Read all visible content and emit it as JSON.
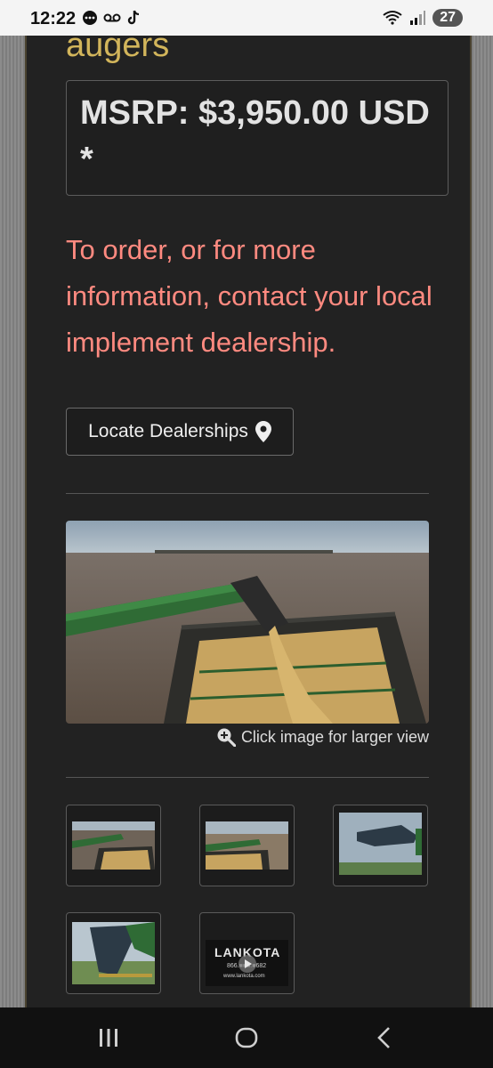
{
  "status_bar": {
    "time": "12:22",
    "left_icons": [
      "chat-icon",
      "voicemail-icon",
      "tiktok-icon"
    ],
    "battery": "27"
  },
  "product": {
    "heading": "augers",
    "msrp": "MSRP: $3,950.00 USD *",
    "contact": "To order, or for more information, contact your local implement dealership.",
    "locate_button": "Locate Dealerships",
    "zoom_caption": "Click image for larger view"
  },
  "thumbnails": [
    {
      "name": "thumb-auger-unloading-1"
    },
    {
      "name": "thumb-auger-unloading-2"
    },
    {
      "name": "thumb-auger-spout-sky"
    },
    {
      "name": "thumb-auger-spout-closeup"
    },
    {
      "name": "thumb-lankota-video",
      "logo_text": "LANKOTA",
      "phone": "866.■■■.■682",
      "site": "www.lankota.com"
    }
  ],
  "nav": {
    "icons": [
      "recent-apps-icon",
      "home-icon",
      "back-icon"
    ]
  },
  "colors": {
    "panel": "#222222",
    "heading": "#d2b55b",
    "contact": "#ff8a80"
  }
}
